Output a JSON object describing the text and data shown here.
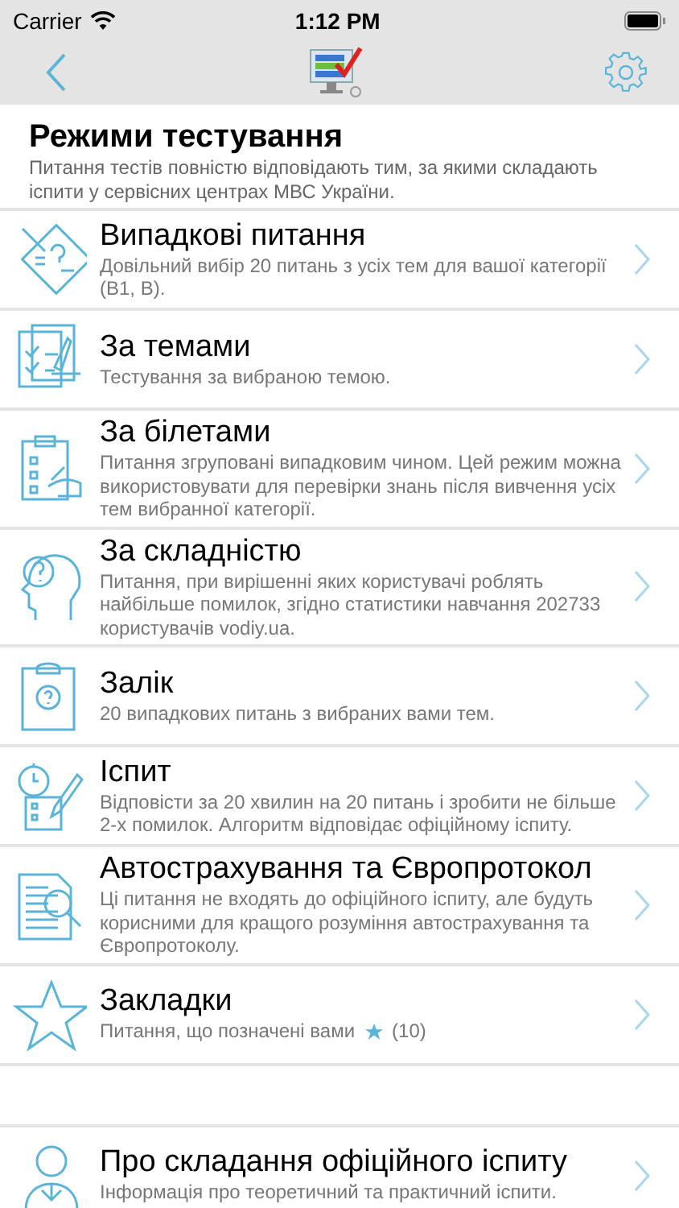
{
  "status_bar": {
    "carrier": "Carrier",
    "time": "1:12 PM"
  },
  "header": {
    "title": "Режими тестування",
    "subtitle": "Питання тестів повністю відповідають тим, за якими складають іспити у сервісних центрах МВС України."
  },
  "modes": [
    {
      "title": "Випадкові питання",
      "subtitle": "Довільний вибір 20 питань з усіх тем для вашої категорії (B1, B)."
    },
    {
      "title": "За темами",
      "subtitle": "Тестування за вибраною темою."
    },
    {
      "title": "За білетами",
      "subtitle": "Питання згруповані випадковим чином. Цей режим можна використовувати для перевірки знань після вивчення усіх тем вибранної категорії."
    },
    {
      "title": "За складністю",
      "subtitle": "Питання, при вирішенні яких користувачі роблять найбільше помилок, згідно статистики навчання 202733 користувачів vodiy.ua."
    },
    {
      "title": "Залік",
      "subtitle": "20 випадкових питань з вибраних вами тем."
    },
    {
      "title": "Іспит",
      "subtitle": "Відповісти за 20 хвилин на 20 питань і зробити не більше 2-х помилок. Алгоритм відповідає офіційному іспиту."
    },
    {
      "title": "Автострахування та Європротокол",
      "subtitle": "Ці питання не входять до офіційного іспиту, але будуть корисними для кращого розуміння автострахування та Європротоколу."
    },
    {
      "title": "Закладки",
      "subtitle": "Питання, що позначені вами",
      "count": "(10)"
    }
  ],
  "info": [
    {
      "title": "Про складання офіційного іспиту",
      "subtitle": "Інформація про теоретичний та практичний іспити."
    }
  ]
}
